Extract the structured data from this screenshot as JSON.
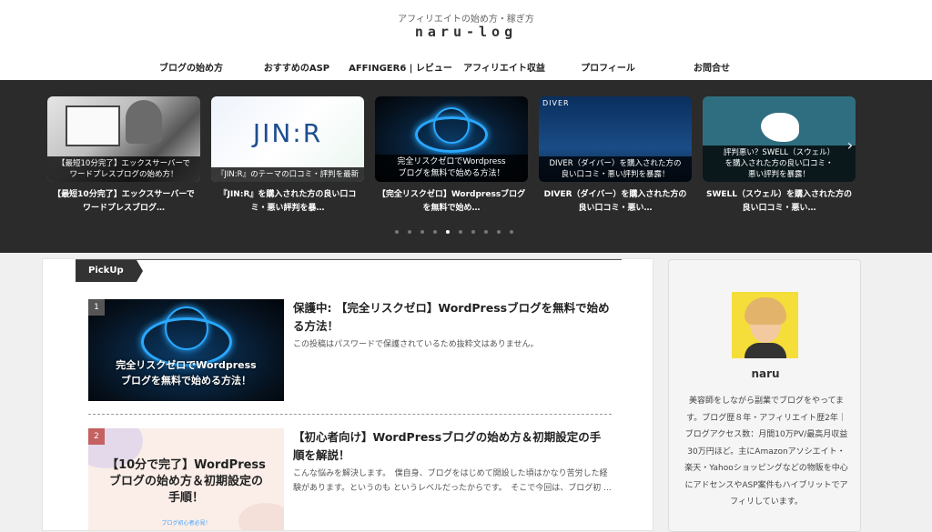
{
  "header": {
    "tagline": "アフィリエイトの始め方・稼ぎ方",
    "logo": "naru-log"
  },
  "nav": [
    {
      "label": "ブログの始め方"
    },
    {
      "label": "おすすめのASP"
    },
    {
      "label": "AFFINGER6 | レビュー"
    },
    {
      "label": "アフィリエイト収益"
    },
    {
      "label": "プロフィール"
    },
    {
      "label": "お問合せ"
    }
  ],
  "carousel": {
    "slides": [
      {
        "caption": "【最短10分完了】エックスサーバーで\nワードプレスブログの始め方！",
        "title": "【最短10分完了】エックスサーバーで\nワードプレスブログ…"
      },
      {
        "caption": "『JIN:R』のテーマの口コミ・評判を最新",
        "brand": "JIN:R",
        "title": "『JIN:R』を購入された方の良い口コ\nミ・悪い評判を暴…"
      },
      {
        "caption": "完全リスクゼロでWordpress\nブログを無料で始める方法！",
        "title": "【完全リスクゼロ】Wordpressブログ\nを無料で始め…"
      },
      {
        "caption": "DIVER（ダイバー）を購入された方の\n良い口コミ・悪い評判を暴露！",
        "brand": "DIVER",
        "title": "DIVER（ダイバー）を購入された方の\n良い口コミ・悪い…"
      },
      {
        "caption": "評判悪い？SWELL（スウェル）\nを購入された方の良い口コミ・\n悪い評判を暴露！",
        "title": "SWELL（スウェル）を購入された方の\n良い口コミ・悪い…"
      }
    ],
    "dot_count": 10,
    "active_dot": 4,
    "arrow_left": "‹",
    "arrow_right": "›"
  },
  "pickup": {
    "label": "PickUp",
    "posts": [
      {
        "rank": "1",
        "thumb_caption": "完全リスクゼロでWordpress\nブログを無料で始める方法！",
        "title": "保護中: 【完全リスクゼロ】WordPressブログを無料で始める方法！",
        "excerpt": "この投稿はパスワードで保護されているため抜粋文はありません。"
      },
      {
        "rank": "2",
        "thumb_caption": "【10分で完了】WordPress\nブログの始め方＆初期設定の\n手順！",
        "thumb_tag": "ブログ初心者必見！",
        "title": "【初心者向け】WordPressブログの始め方＆初期設定の手順を解説！",
        "excerpt": "こんな悩みを解決します。　僕自身、ブログをはじめて開設した頃はかなり苦労した経験があります。というのも というレベルだったからです。　そこで今回は、ブログ初 ..."
      }
    ]
  },
  "sidebar": {
    "name": "naru",
    "bio": "美容師をしながら副業でブログをやってます。ブログ歴８年・アフィリエイト歴2年｜ブログアクセス数：月間10万PV/最高月収益30万円ほど。主にAmazonアソシエイト・楽天・Yahooショッピングなどの物販を中心にアドセンスやASP案件もハイブリットでアフィリしています。"
  },
  "colors": {
    "carousel_bg": "#2b2b2b",
    "pickup_label_bg": "#333333",
    "avatar_bg": "#f5dd3a",
    "rank2": "#c46161"
  }
}
